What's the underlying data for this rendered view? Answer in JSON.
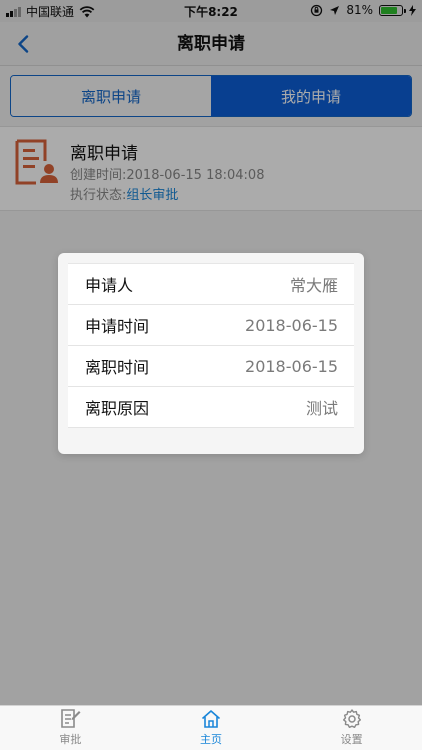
{
  "status_bar": {
    "carrier": "中国联通",
    "time": "下午8:22",
    "battery": "81%",
    "battery_level": 0.81
  },
  "nav": {
    "title": "离职申请"
  },
  "segment": {
    "left_label": "离职申请",
    "right_label": "我的申请",
    "active": "right"
  },
  "card": {
    "title": "离职申请",
    "time_label": "创建时间:",
    "time_value": "2018-06-15 18:04:08",
    "state_label": "执行状态:",
    "state_value": "组长审批"
  },
  "modal": {
    "rows": [
      {
        "key": "申请人",
        "value": "常大雁"
      },
      {
        "key": "申请时间",
        "value": "2018-06-15"
      },
      {
        "key": "离职时间",
        "value": "2018-06-15"
      },
      {
        "key": "离职原因",
        "value": "测试"
      }
    ]
  },
  "tabbar": {
    "items": [
      {
        "label": "审批",
        "icon": "approve-icon"
      },
      {
        "label": "主页",
        "icon": "home-icon"
      },
      {
        "label": "设置",
        "icon": "gear-icon"
      }
    ],
    "active_index": 1
  },
  "colors": {
    "accent": "#0d5ed7",
    "link": "#1a86d9",
    "icon_orange": "#d9633b"
  }
}
